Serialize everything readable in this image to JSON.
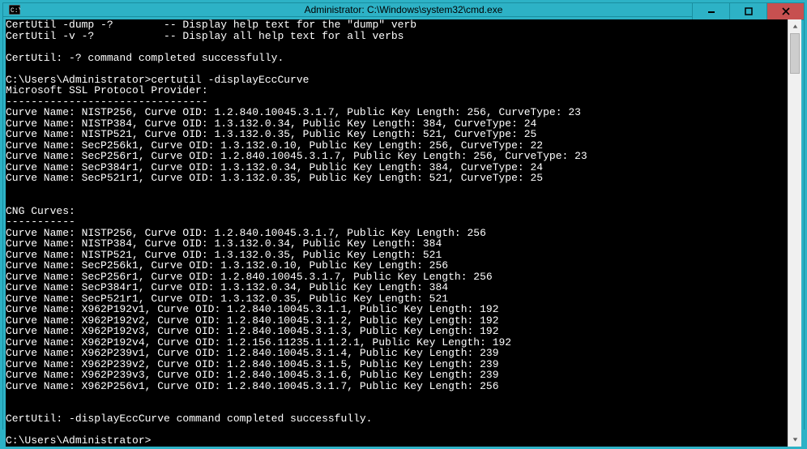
{
  "window": {
    "title": "Administrator: C:\\Windows\\system32\\cmd.exe"
  },
  "icons": {
    "cmd": "cmd-icon",
    "minimize": "minimize-icon",
    "maximize": "maximize-icon",
    "close": "close-icon"
  },
  "console": {
    "lines": [
      "CertUtil -dump -?        -- Display help text for the \"dump\" verb",
      "CertUtil -v -?           -- Display all help text for all verbs",
      "",
      "CertUtil: -? command completed successfully.",
      "",
      "C:\\Users\\Administrator>certutil -displayEccCurve",
      "Microsoft SSL Protocol Provider:",
      "--------------------------------",
      "Curve Name: NISTP256, Curve OID: 1.2.840.10045.3.1.7, Public Key Length: 256, CurveType: 23",
      "Curve Name: NISTP384, Curve OID: 1.3.132.0.34, Public Key Length: 384, CurveType: 24",
      "Curve Name: NISTP521, Curve OID: 1.3.132.0.35, Public Key Length: 521, CurveType: 25",
      "Curve Name: SecP256k1, Curve OID: 1.3.132.0.10, Public Key Length: 256, CurveType: 22",
      "Curve Name: SecP256r1, Curve OID: 1.2.840.10045.3.1.7, Public Key Length: 256, CurveType: 23",
      "Curve Name: SecP384r1, Curve OID: 1.3.132.0.34, Public Key Length: 384, CurveType: 24",
      "Curve Name: SecP521r1, Curve OID: 1.3.132.0.35, Public Key Length: 521, CurveType: 25",
      "",
      "",
      "CNG Curves:",
      "-----------",
      "Curve Name: NISTP256, Curve OID: 1.2.840.10045.3.1.7, Public Key Length: 256",
      "Curve Name: NISTP384, Curve OID: 1.3.132.0.34, Public Key Length: 384",
      "Curve Name: NISTP521, Curve OID: 1.3.132.0.35, Public Key Length: 521",
      "Curve Name: SecP256k1, Curve OID: 1.3.132.0.10, Public Key Length: 256",
      "Curve Name: SecP256r1, Curve OID: 1.2.840.10045.3.1.7, Public Key Length: 256",
      "Curve Name: SecP384r1, Curve OID: 1.3.132.0.34, Public Key Length: 384",
      "Curve Name: SecP521r1, Curve OID: 1.3.132.0.35, Public Key Length: 521",
      "Curve Name: X962P192v1, Curve OID: 1.2.840.10045.3.1.1, Public Key Length: 192",
      "Curve Name: X962P192v2, Curve OID: 1.2.840.10045.3.1.2, Public Key Length: 192",
      "Curve Name: X962P192v3, Curve OID: 1.2.840.10045.3.1.3, Public Key Length: 192",
      "Curve Name: X962P192v4, Curve OID: 1.2.156.11235.1.1.2.1, Public Key Length: 192",
      "Curve Name: X962P239v1, Curve OID: 1.2.840.10045.3.1.4, Public Key Length: 239",
      "Curve Name: X962P239v2, Curve OID: 1.2.840.10045.3.1.5, Public Key Length: 239",
      "Curve Name: X962P239v3, Curve OID: 1.2.840.10045.3.1.6, Public Key Length: 239",
      "Curve Name: X962P256v1, Curve OID: 1.2.840.10045.3.1.7, Public Key Length: 256",
      "",
      "",
      "CertUtil: -displayEccCurve command completed successfully.",
      "",
      "C:\\Users\\Administrator>"
    ]
  }
}
